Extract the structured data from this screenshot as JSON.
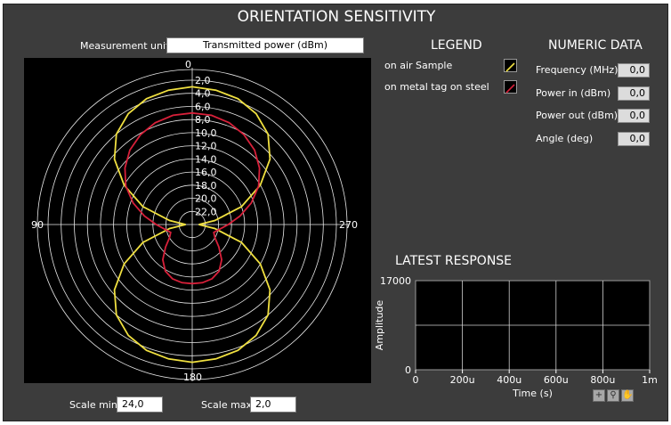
{
  "title": "ORIENTATION SENSITIVITY",
  "measurement": {
    "label": "Measurement unit",
    "value": "Transmitted power (dBm)"
  },
  "polar": {
    "angle_labels": {
      "top": "0",
      "left": "90",
      "right": "270",
      "bottom": "180"
    },
    "ring_labels": [
      "2,0",
      "4,0",
      "6,0",
      "8,0",
      "10,0",
      "12,0",
      "14,0",
      "16,0",
      "18,0",
      "20,0",
      "22,0"
    ],
    "scale_center": 24,
    "scale_outer": 2,
    "grid_color": "#e8e8e8"
  },
  "legend": {
    "title": "LEGEND",
    "items": [
      {
        "label": "on air Sample",
        "color": "#f0e040"
      },
      {
        "label": "on metal tag on steel",
        "color": "#d8203a"
      }
    ]
  },
  "numeric": {
    "title": "NUMERIC DATA",
    "fields": [
      {
        "label": "Frequency (MHz)",
        "value": "0,0"
      },
      {
        "label": "Power in (dBm)",
        "value": "0,0"
      },
      {
        "label": "Power out (dBm)",
        "value": "0,0"
      },
      {
        "label": "Angle (deg)",
        "value": "0,0"
      }
    ]
  },
  "response": {
    "title": "LATEST RESPONSE",
    "ylabel": "Amplitude",
    "xlabel": "Time (s)",
    "y_ticks": [
      "17000",
      "0"
    ],
    "x_ticks": [
      "0",
      "200u",
      "400u",
      "600u",
      "800u",
      "1m"
    ]
  },
  "scale": {
    "min_label": "Scale min",
    "min_value": "24,0",
    "max_label": "Scale max",
    "max_value": "2,0"
  },
  "tools": [
    "cursor-tool-icon",
    "zoom-tool-icon",
    "pan-hand-icon"
  ],
  "chart_data": {
    "type": "line",
    "title": "",
    "xlabel": "",
    "ylabel": "",
    "note_axes": "polar: angle in degrees 0-360, radial value in dBm, center 24,0 outer 2,0",
    "series": [
      {
        "name": "on air Sample",
        "color": "#f0e040",
        "points": [
          [
            0,
            3.0
          ],
          [
            10,
            3.2
          ],
          [
            20,
            3.6
          ],
          [
            30,
            4.5
          ],
          [
            40,
            6.0
          ],
          [
            50,
            8.5
          ],
          [
            60,
            12.0
          ],
          [
            70,
            16.0
          ],
          [
            80,
            20.5
          ],
          [
            90,
            23.0
          ],
          [
            100,
            20.5
          ],
          [
            110,
            16.0
          ],
          [
            120,
            12.0
          ],
          [
            130,
            8.5
          ],
          [
            140,
            6.0
          ],
          [
            150,
            4.5
          ],
          [
            160,
            3.6
          ],
          [
            170,
            3.2
          ],
          [
            180,
            3.0
          ],
          [
            190,
            3.2
          ],
          [
            200,
            3.6
          ],
          [
            210,
            4.5
          ],
          [
            220,
            6.0
          ],
          [
            230,
            8.5
          ],
          [
            240,
            12.0
          ],
          [
            250,
            16.0
          ],
          [
            260,
            20.5
          ],
          [
            270,
            23.0
          ],
          [
            280,
            20.5
          ],
          [
            290,
            16.0
          ],
          [
            300,
            12.0
          ],
          [
            310,
            8.5
          ],
          [
            320,
            6.0
          ],
          [
            330,
            4.5
          ],
          [
            340,
            3.6
          ],
          [
            350,
            3.2
          ]
        ]
      },
      {
        "name": "on metal tag on steel",
        "color": "#d8203a",
        "points": [
          [
            0,
            7.0
          ],
          [
            10,
            7.1
          ],
          [
            20,
            7.5
          ],
          [
            30,
            8.2
          ],
          [
            40,
            9.2
          ],
          [
            50,
            10.6
          ],
          [
            60,
            12.3
          ],
          [
            70,
            14.4
          ],
          [
            80,
            16.6
          ],
          [
            90,
            18.5
          ],
          [
            100,
            19.8
          ],
          [
            110,
            20.5
          ],
          [
            120,
            20.0
          ],
          [
            130,
            18.7
          ],
          [
            140,
            17.0
          ],
          [
            150,
            15.8
          ],
          [
            160,
            15.2
          ],
          [
            170,
            15.0
          ],
          [
            180,
            15.0
          ],
          [
            190,
            15.0
          ],
          [
            200,
            15.2
          ],
          [
            210,
            15.8
          ],
          [
            220,
            17.0
          ],
          [
            230,
            18.7
          ],
          [
            240,
            20.0
          ],
          [
            250,
            20.5
          ],
          [
            260,
            19.8
          ],
          [
            270,
            18.5
          ],
          [
            280,
            16.6
          ],
          [
            290,
            14.4
          ],
          [
            300,
            12.3
          ],
          [
            310,
            10.6
          ],
          [
            320,
            9.2
          ],
          [
            330,
            8.2
          ],
          [
            340,
            7.5
          ],
          [
            350,
            7.1
          ]
        ]
      }
    ]
  }
}
